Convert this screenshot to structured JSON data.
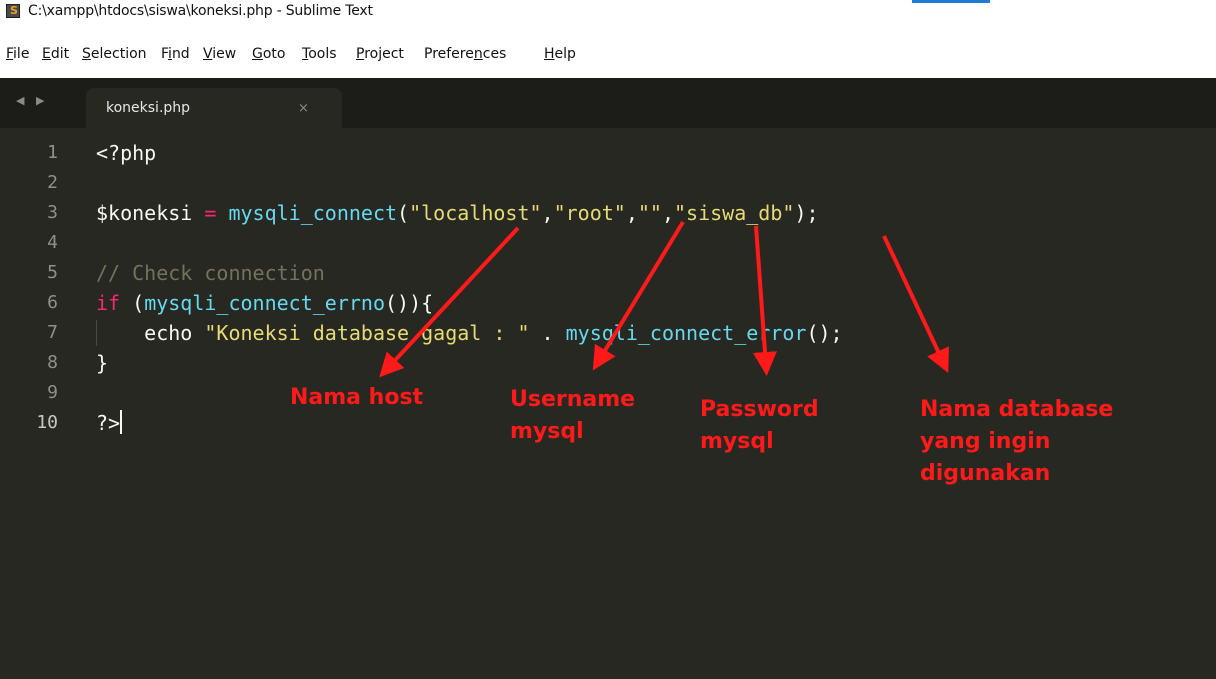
{
  "window": {
    "title": "C:\\xampp\\htdocs\\siswa\\koneksi.php - Sublime Text",
    "app_icon": "sublime-text-icon"
  },
  "menu": [
    {
      "pre": "",
      "ul": "F",
      "post": "ile"
    },
    {
      "pre": "",
      "ul": "E",
      "post": "dit"
    },
    {
      "pre": "",
      "ul": "S",
      "post": "election"
    },
    {
      "pre": "F",
      "ul": "i",
      "post": "nd"
    },
    {
      "pre": "",
      "ul": "V",
      "post": "iew"
    },
    {
      "pre": "",
      "ul": "G",
      "post": "oto"
    },
    {
      "pre": "",
      "ul": "T",
      "post": "ools"
    },
    {
      "pre": "",
      "ul": "P",
      "post": "roject"
    },
    {
      "pre": "Prefere",
      "ul": "n",
      "post": "ces"
    },
    {
      "pre": "",
      "ul": "H",
      "post": "elp"
    }
  ],
  "tabs": {
    "nav_arrows": "◀ ▶",
    "active_tab": {
      "label": "koneksi.php",
      "close": "×"
    }
  },
  "code": {
    "line_numbers": [
      "1",
      "2",
      "3",
      "4",
      "5",
      "6",
      "7",
      "8",
      "9",
      "10"
    ],
    "l1": "<?php",
    "l3": {
      "var": "$koneksi",
      "eq": " = ",
      "fn": "mysqli_connect",
      "p1": "(",
      "s1": "\"localhost\"",
      "c1": ",",
      "s2": "\"root\"",
      "c2": ",",
      "s3": "\"\"",
      "c3": ",",
      "s4": "\"siswa_db\"",
      "p2": ");"
    },
    "l5": "// Check connection",
    "l6": {
      "kw": "if",
      "p1": " (",
      "fn": "mysqli_connect_errno",
      "p2": "()){"
    },
    "l7": {
      "indent": "    ",
      "kw": "echo",
      "sp": " ",
      "str": "\"Koneksi database gagal : \"",
      "dot": " . ",
      "fn": "mysqli_connect_error",
      "p": "();"
    },
    "l8": "}",
    "l10": "?>"
  },
  "annotations": {
    "host": "Nama host",
    "username": [
      "Username",
      "mysql"
    ],
    "password": [
      "Password",
      "mysql"
    ],
    "database": [
      "Nama database",
      "yang ingin",
      "digunakan"
    ],
    "color": "#ff1a1a"
  }
}
